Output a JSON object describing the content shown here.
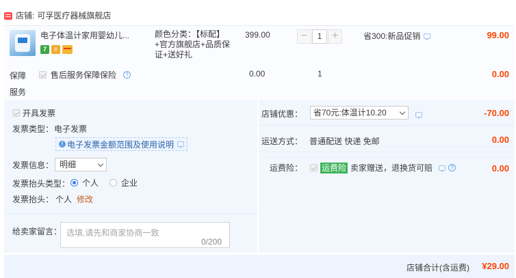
{
  "shop": {
    "label": "店铺",
    "separator": ":",
    "name": "可孚医疗器械旗舰店"
  },
  "item": {
    "title": "电子体温计家用婴幼儿...",
    "sku": "颜色分类：【标配】+官方旗舰店+品质保证+送好礼",
    "price": "399.00",
    "qty": "1",
    "minus": "−",
    "plus": "+",
    "promo": "省300:新品促销",
    "total": "99.00",
    "badges": [
      "7",
      "♕"
    ]
  },
  "service": {
    "label": "保障服务",
    "option": "售后服务保障保险",
    "price": "0.00",
    "qty": "1",
    "total": "0.00"
  },
  "invoice": {
    "open_label": "开具发票",
    "type_label": "发票类型：",
    "type_value": "电子发票",
    "help_link": "电子发票金额范围及使用说明",
    "info_label": "发票信息：",
    "info_value": "明细",
    "header_type_label": "发票抬头类型：",
    "header_type_options": [
      "个人",
      "企业"
    ],
    "header_label": "发票抬头：",
    "header_value": "个人",
    "edit": "修改"
  },
  "message": {
    "label": "给卖家留言：",
    "placeholder": "选填,请先和商家协商一致",
    "count": "0/200"
  },
  "coupon": {
    "label": "店铺优惠：",
    "value": "省70元:体温计10.20",
    "total": "-70.00"
  },
  "shipping": {
    "label": "运送方式：",
    "value": "普通配送 快递 免邮",
    "total": "0.00"
  },
  "insurance": {
    "label": "运费险：",
    "tag": "运费险",
    "desc": "卖家赠送，退换货可赔",
    "total": "0.00"
  },
  "footer": {
    "label": "店铺合计(含运费)",
    "total": "¥29.00"
  },
  "colors": {
    "price_red": "#ff4400",
    "panel_bg": "#f2f7fe",
    "link_blue": "#2a62a8",
    "insurance_green": "#3db35a"
  }
}
